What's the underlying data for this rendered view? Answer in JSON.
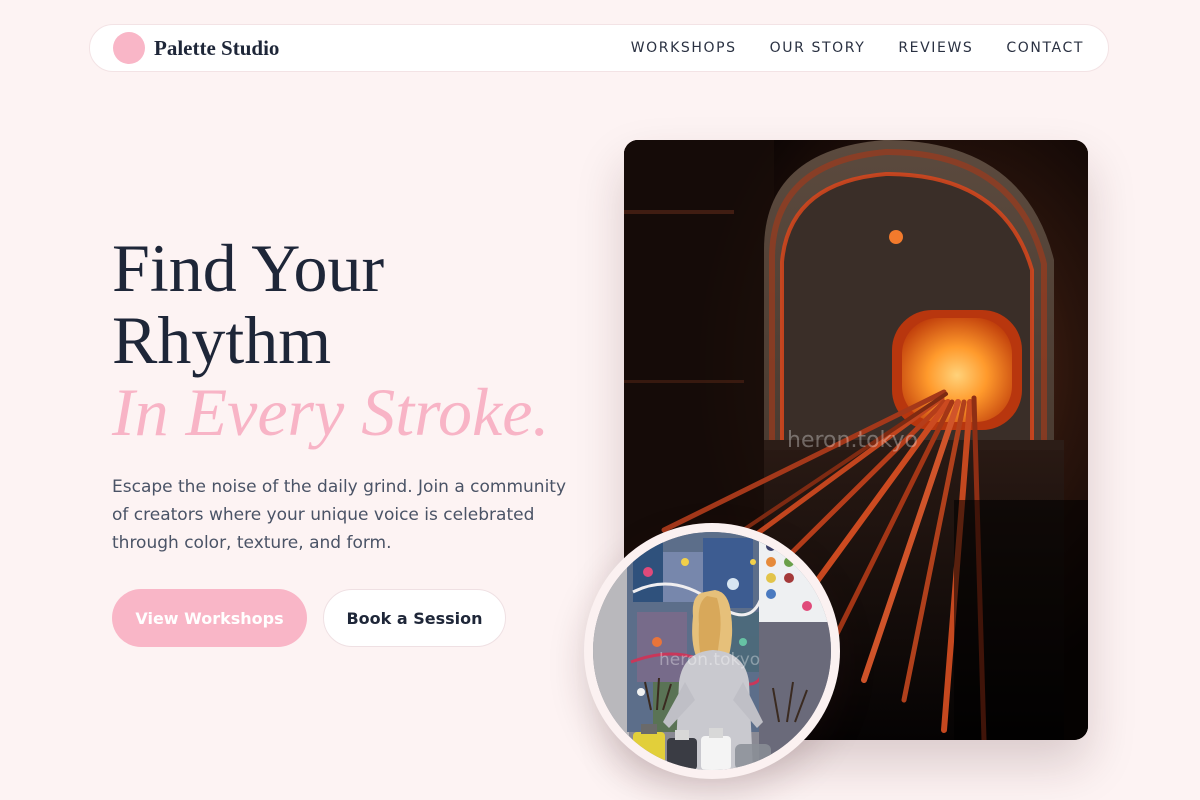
{
  "nav": {
    "brand": "Palette Studio",
    "links": [
      "WORKSHOPS",
      "OUR STORY",
      "REVIEWS",
      "CONTACT"
    ]
  },
  "hero": {
    "title_line1": "Find Your",
    "title_line2": "Rhythm",
    "title_accent": "In Every Stroke.",
    "description": "Escape the noise of the daily grind. Join a community of creators where your unique voice is celebrated through color, texture, and form.",
    "primary_button": "View Workshops",
    "secondary_button": "Book a Session"
  },
  "images": {
    "main_watermark": "heron.tokyo",
    "circle_watermark": "heron.tokyo"
  },
  "colors": {
    "background": "#fdf3f3",
    "accent_pink": "#f9b6c7",
    "text_dark": "#1e2638",
    "text_body": "#4a5366"
  }
}
